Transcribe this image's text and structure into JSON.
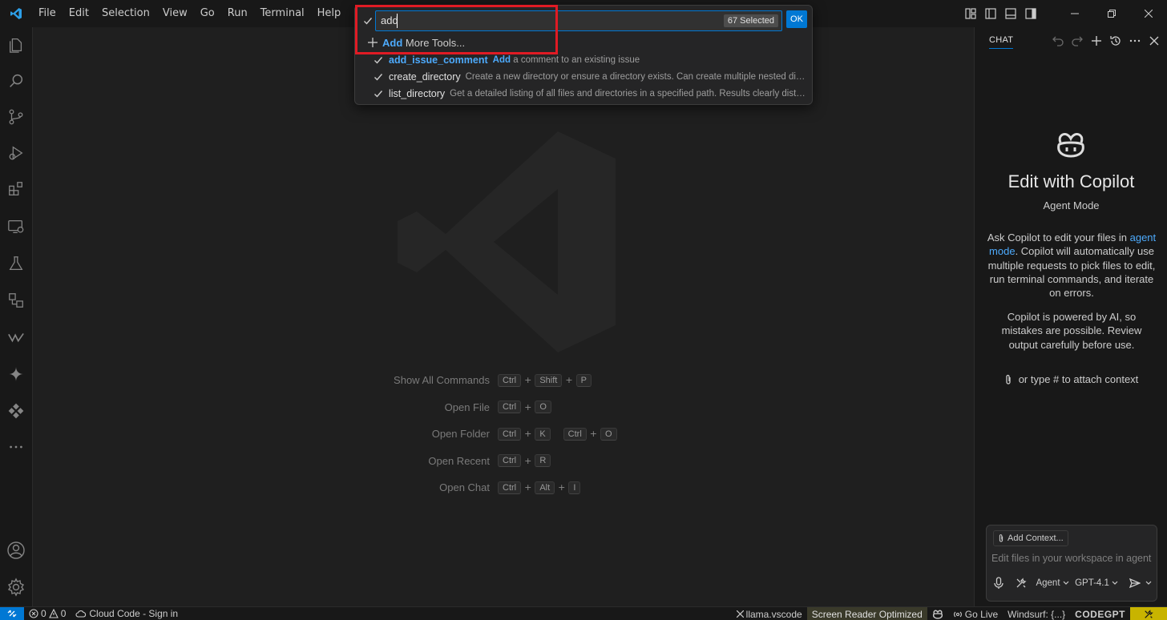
{
  "menu": [
    "File",
    "Edit",
    "Selection",
    "View",
    "Go",
    "Run",
    "Terminal",
    "Help"
  ],
  "activity_icons": [
    "explorer-icon",
    "search-icon",
    "source-control-icon",
    "run-debug-icon",
    "extensions-icon",
    "remote-explorer-icon",
    "testing-icon",
    "containers-icon",
    "windsurf-icon",
    "gemini-icon",
    "codegpt-icon",
    "more-icon",
    "account-icon",
    "settings-icon"
  ],
  "quickpick": {
    "input_value": "add",
    "selected_badge": "67 Selected",
    "ok_label": "OK",
    "add_more_prefix": "Add",
    "add_more_suffix": "More Tools...",
    "items": [
      {
        "name": "add_issue_comment",
        "desc_hl": "Add",
        "desc": "a comment to an existing issue"
      },
      {
        "name": "create_directory",
        "desc": "Create a new directory or ensure a directory exists. Can create multiple nested dire..."
      },
      {
        "name": "list_directory",
        "desc": "Get a detailed listing of all files and directories in a specified path. Results clearly disti..."
      }
    ]
  },
  "shortcuts": [
    {
      "label": "Show All Commands",
      "keys": [
        "Ctrl",
        "+",
        "Shift",
        "+",
        "P"
      ]
    },
    {
      "label": "Open File",
      "keys": [
        "Ctrl",
        "+",
        "O"
      ]
    },
    {
      "label": "Open Folder",
      "keys": [
        "Ctrl",
        "+",
        "K",
        " ",
        "Ctrl",
        "+",
        "O"
      ]
    },
    {
      "label": "Open Recent",
      "keys": [
        "Ctrl",
        "+",
        "R"
      ]
    },
    {
      "label": "Open Chat",
      "keys": [
        "Ctrl",
        "+",
        "Alt",
        "+",
        "I"
      ]
    }
  ],
  "chat": {
    "tab": "CHAT",
    "title": "Edit with Copilot",
    "subtitle": "Agent Mode",
    "p1_before": "Ask Copilot to edit your files in",
    "p1_link": "agent mode",
    "p1_after": ". Copilot will automatically use multiple requests to pick files to edit, run terminal commands, and iterate on errors.",
    "p2": "Copilot is powered by AI, so mistakes are possible. Review output carefully before use.",
    "attach_hint": "or type # to attach context",
    "add_context": "Add Context...",
    "placeholder": "Edit files in your workspace in agent",
    "mode": "Agent",
    "model": "GPT-4.1"
  },
  "status": {
    "errors": "0",
    "warnings": "0",
    "cloud_code": "Cloud Code - Sign in",
    "llama": "llama.vscode",
    "screen_reader": "Screen Reader Optimized",
    "go_live": "Go Live",
    "windsurf": "Windsurf: {...}",
    "codegpt": "CODEGPT"
  }
}
